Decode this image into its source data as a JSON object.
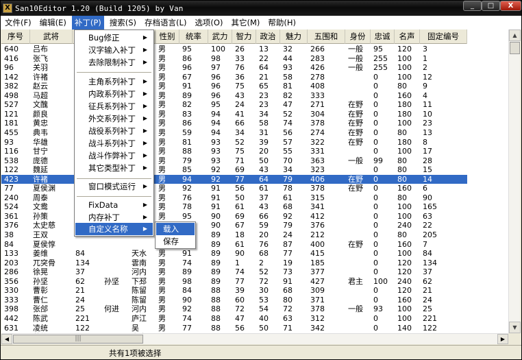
{
  "window": {
    "title": "San10Editor 1.20 (Build 1205) by Van",
    "min": "_",
    "max": "□",
    "close": "X"
  },
  "menubar": [
    "文件(F)",
    "编辑(E)",
    "补丁(P)",
    "搜索(S)",
    "存档语言(L)",
    "选项(O)",
    "其它(M)",
    "帮助(H)"
  ],
  "columns": [
    "序号",
    "武将",
    "",
    "",
    "所在",
    "性别",
    "统率",
    "武力",
    "智力",
    "政治",
    "魅力",
    "五围和",
    "身份",
    "忠诚",
    "名声",
    "固定编号"
  ],
  "rows": [
    [
      "640",
      "吕布",
      "",
      "",
      "晋阳",
      "男",
      "95",
      "100",
      "26",
      "13",
      "32",
      "266",
      "一般",
      "95",
      "120",
      "3"
    ],
    [
      "416",
      "张飞",
      "",
      "",
      "刘备",
      "男",
      "86",
      "98",
      "33",
      "22",
      "44",
      "283",
      "一般",
      "255",
      "100",
      "1"
    ],
    [
      "96",
      "关羽",
      "",
      "",
      "刘备",
      "男",
      "96",
      "97",
      "76",
      "64",
      "93",
      "426",
      "一般",
      "255",
      "100",
      "2"
    ],
    [
      "142",
      "许褚",
      "",
      "",
      "陈留",
      "男",
      "67",
      "96",
      "36",
      "21",
      "58",
      "278",
      "",
      "0",
      "100",
      "12"
    ],
    [
      "382",
      "赵云",
      "",
      "",
      "北平",
      "男",
      "91",
      "96",
      "75",
      "65",
      "81",
      "408",
      "",
      "0",
      "80",
      "9"
    ],
    [
      "498",
      "马超",
      "",
      "",
      "武威",
      "男",
      "89",
      "96",
      "43",
      "23",
      "82",
      "333",
      "",
      "0",
      "160",
      "4"
    ],
    [
      "527",
      "文醜",
      "",
      "",
      "南皮",
      "男",
      "82",
      "95",
      "24",
      "23",
      "47",
      "271",
      "在野",
      "0",
      "180",
      "11"
    ],
    [
      "121",
      "颜良",
      "",
      "",
      "南皮",
      "男",
      "83",
      "94",
      "41",
      "34",
      "52",
      "304",
      "在野",
      "0",
      "180",
      "10"
    ],
    [
      "181",
      "黄忠",
      "",
      "",
      "宛",
      "男",
      "86",
      "94",
      "66",
      "58",
      "74",
      "378",
      "在野",
      "0",
      "100",
      "23"
    ],
    [
      "455",
      "典韦",
      "",
      "",
      "陈留",
      "男",
      "59",
      "94",
      "34",
      "31",
      "56",
      "274",
      "在野",
      "0",
      "80",
      "13"
    ],
    [
      "93",
      "华雄",
      "",
      "",
      "天水",
      "男",
      "81",
      "93",
      "52",
      "39",
      "57",
      "322",
      "在野",
      "0",
      "180",
      "8"
    ],
    [
      "116",
      "甘宁",
      "",
      "",
      "江州",
      "男",
      "88",
      "93",
      "75",
      "20",
      "55",
      "331",
      "",
      "0",
      "100",
      "17"
    ],
    [
      "538",
      "庞德",
      "",
      "",
      "武威",
      "男",
      "79",
      "93",
      "71",
      "50",
      "70",
      "363",
      "一般",
      "99",
      "80",
      "28"
    ],
    [
      "122",
      "魏延",
      "",
      "",
      "汝南",
      "男",
      "85",
      "92",
      "69",
      "43",
      "34",
      "323",
      "",
      "0",
      "80",
      "15"
    ],
    [
      "423",
      "许褚",
      "",
      "",
      "晋阳",
      "男",
      "94",
      "92",
      "77",
      "64",
      "79",
      "406",
      "在野",
      "0",
      "80",
      "14"
    ],
    [
      "77",
      "夏侯渊",
      "",
      "",
      "陈留",
      "男",
      "92",
      "91",
      "56",
      "61",
      "78",
      "378",
      "在野",
      "0",
      "160",
      "6"
    ],
    [
      "240",
      "周泰",
      "",
      "",
      "柴桑",
      "男",
      "76",
      "91",
      "50",
      "37",
      "61",
      "315",
      "",
      "0",
      "80",
      "90"
    ],
    [
      "524",
      "文鸯",
      "",
      "",
      "陈留",
      "男",
      "78",
      "91",
      "61",
      "43",
      "68",
      "341",
      "",
      "0",
      "100",
      "165"
    ],
    [
      "361",
      "孙策",
      "",
      "",
      "吴",
      "男",
      "95",
      "90",
      "69",
      "66",
      "92",
      "412",
      "",
      "0",
      "100",
      "63"
    ],
    [
      "376",
      "太史慈",
      "",
      "",
      "北海",
      "男",
      "81",
      "90",
      "67",
      "59",
      "79",
      "376",
      "",
      "0",
      "240",
      "22"
    ],
    [
      "38",
      "王双",
      "",
      "",
      "",
      "男",
      "61",
      "89",
      "18",
      "20",
      "24",
      "212",
      "",
      "0",
      "80",
      "205"
    ],
    [
      "84",
      "夏侯惇",
      "",
      "",
      "",
      "男",
      "87",
      "89",
      "61",
      "76",
      "87",
      "400",
      "在野",
      "0",
      "160",
      "7"
    ],
    [
      "133",
      "姜维",
      "84",
      "",
      "天水",
      "男",
      "91",
      "89",
      "90",
      "68",
      "77",
      "415",
      "",
      "0",
      "100",
      "84"
    ],
    [
      "203",
      "兀突骨",
      "134",
      "",
      "雲南",
      "男",
      "74",
      "89",
      "1",
      "2",
      "19",
      "185",
      "",
      "0",
      "120",
      "134"
    ],
    [
      "286",
      "徐晃",
      "37",
      "",
      "河内",
      "男",
      "89",
      "89",
      "74",
      "52",
      "73",
      "377",
      "",
      "0",
      "120",
      "37"
    ],
    [
      "356",
      "孙坚",
      "62",
      "孙坚",
      "下邳",
      "男",
      "98",
      "89",
      "77",
      "72",
      "91",
      "427",
      "君主",
      "100",
      "240",
      "62"
    ],
    [
      "330",
      "曹彰",
      "21",
      "",
      "陈留",
      "男",
      "84",
      "88",
      "39",
      "30",
      "68",
      "309",
      "",
      "0",
      "120",
      "21"
    ],
    [
      "333",
      "曹仁",
      "24",
      "",
      "陈留",
      "男",
      "90",
      "88",
      "60",
      "53",
      "80",
      "371",
      "",
      "0",
      "160",
      "24"
    ],
    [
      "398",
      "张郃",
      "25",
      "何进",
      "河内",
      "男",
      "92",
      "88",
      "72",
      "54",
      "72",
      "378",
      "一般",
      "93",
      "100",
      "25"
    ],
    [
      "442",
      "陈武",
      "221",
      "",
      "庐江",
      "男",
      "74",
      "88",
      "47",
      "40",
      "63",
      "312",
      "",
      "0",
      "100",
      "221"
    ],
    [
      "631",
      "凌统",
      "122",
      "",
      "吴",
      "男",
      "77",
      "88",
      "56",
      "50",
      "71",
      "342",
      "",
      "0",
      "140",
      "122"
    ],
    [
      "264",
      "蒋钦",
      "212",
      "",
      "寿春",
      "男",
      "78",
      "87",
      "53",
      "42",
      "78",
      "338",
      "",
      "0",
      "100",
      "212"
    ]
  ],
  "rows_col4": [
    "晋阳",
    "刘备",
    "刘备",
    "陈留",
    "北平",
    "武威",
    "南皮",
    "南皮",
    "宛",
    "陈留",
    "天水",
    "江州",
    "武威",
    "汝南",
    "晋阳",
    "陈留",
    "柴桑",
    "陈留",
    "吴",
    "北海",
    "",
    "",
    "天水",
    "雲南",
    "河内",
    "下邳",
    "陈留",
    "陈留",
    "河内",
    "庐江",
    "吴",
    "寿春"
  ],
  "selected_row_index": 14,
  "patch_menu": {
    "items": [
      "Bug修正",
      "汉字输入补丁",
      "去除限制补丁",
      "主角系列补丁",
      "内政系列补丁",
      "征兵系列补丁",
      "外交系列补丁",
      "战役系列补丁",
      "战斗系列补丁",
      "战斗作弊补丁",
      "其它类型补丁",
      "窗口模式运行",
      "FixData",
      "内存补丁",
      "自定义名称"
    ],
    "highlighted": "自定义名称"
  },
  "submenu": {
    "items": [
      "载入",
      "保存"
    ],
    "highlighted": "载入"
  },
  "status": "共有1项被选择",
  "colors": {
    "selection": "#316ac5",
    "titlebar": "#111111",
    "close": "#c0301c"
  }
}
